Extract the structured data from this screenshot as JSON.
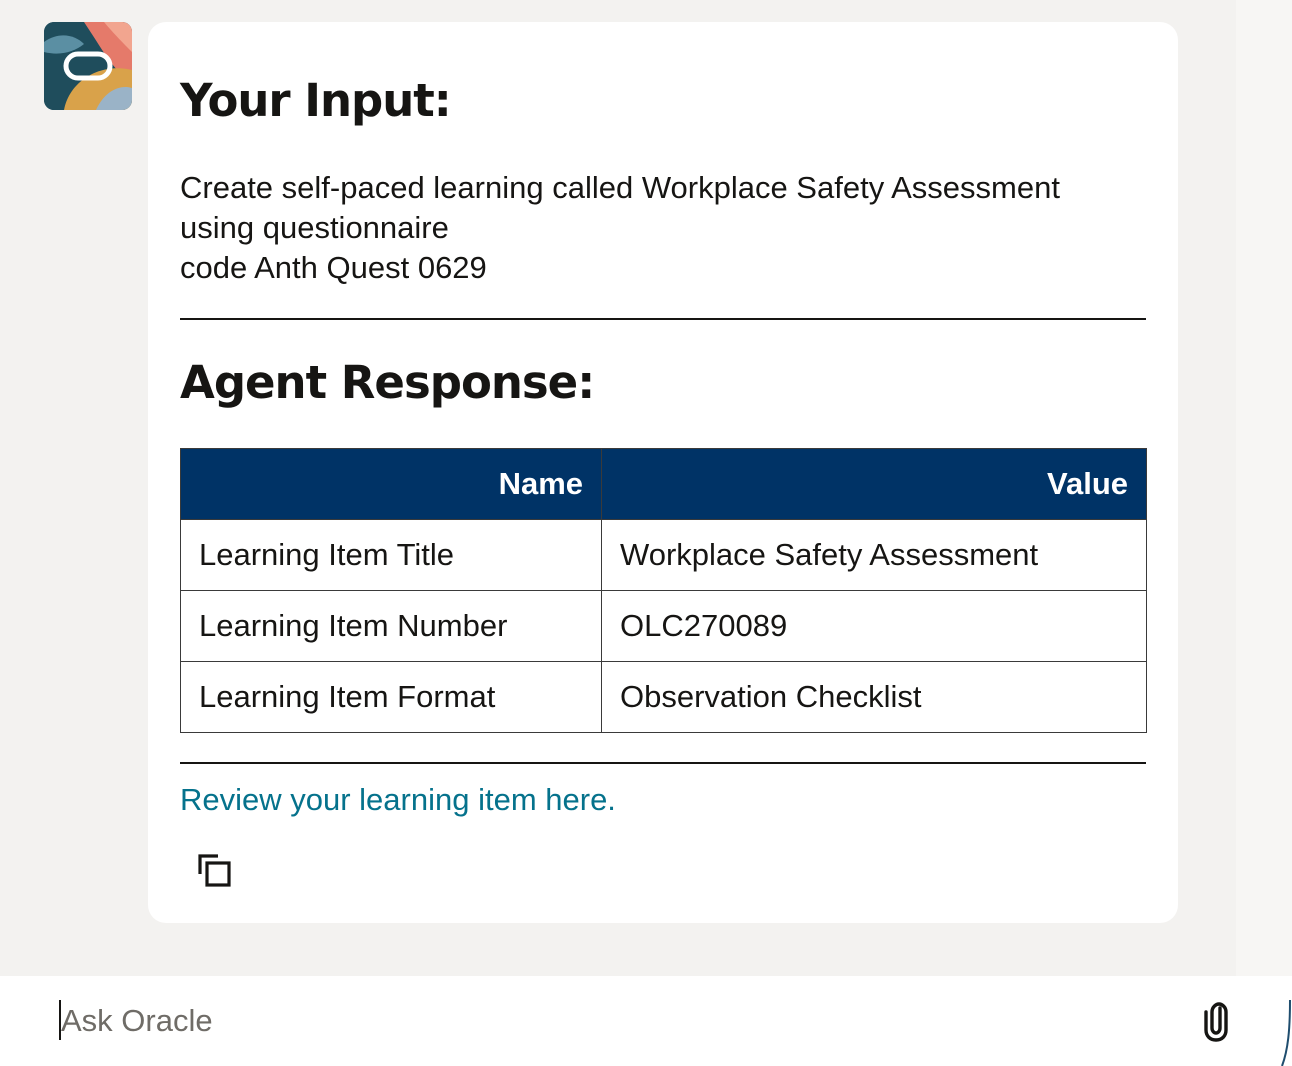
{
  "avatar": {
    "icon": "oracle-logo-icon"
  },
  "message": {
    "input_heading": "Your Input:",
    "input_lines": [
      "Create self-paced learning called Workplace Safety Assessment",
      "using questionnaire",
      "code Anth Quest 0629"
    ],
    "response_heading": "Agent Response:",
    "table": {
      "headers": [
        "Name",
        "Value"
      ],
      "rows": [
        [
          "Learning Item Title",
          "Workplace Safety Assessment"
        ],
        [
          "Learning Item Number",
          "OLC270089"
        ],
        [
          "Learning Item Format",
          "Observation Checklist"
        ]
      ]
    },
    "review_link": "Review your learning item here.",
    "copy_icon": "copy-icon"
  },
  "composer": {
    "placeholder": "Ask Oracle",
    "value": "",
    "attach_icon": "paperclip-icon"
  },
  "colors": {
    "table_header_bg": "#003366",
    "link": "#05728c",
    "page_bg": "#f3f2f0",
    "card_bg": "#ffffff"
  }
}
